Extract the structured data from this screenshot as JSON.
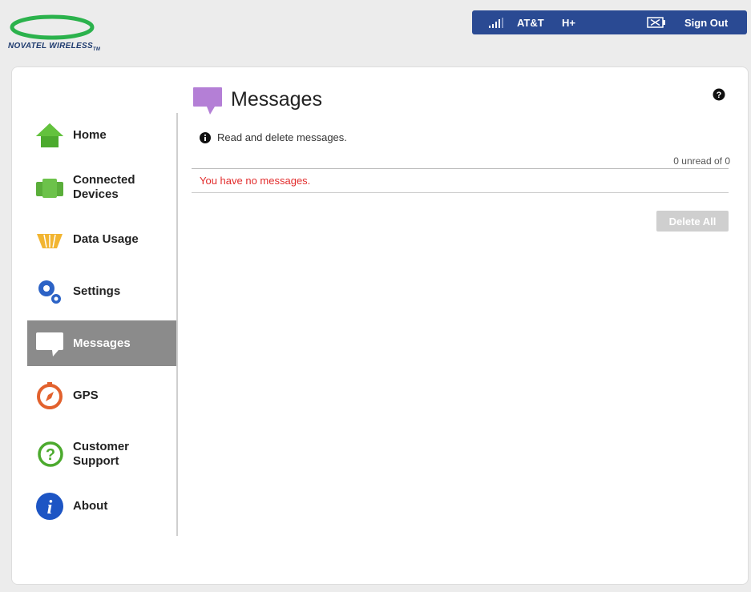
{
  "brand": {
    "logo_text": "NOVATEL WIRELESS",
    "logo_mark": "TM"
  },
  "status": {
    "carrier": "AT&T",
    "network": "H+",
    "sign_out_label": "Sign Out"
  },
  "nav": {
    "items": [
      {
        "label": "Home",
        "icon": "home-icon"
      },
      {
        "label": "Connected Devices",
        "icon": "connected-devices-icon"
      },
      {
        "label": "Data Usage",
        "icon": "data-usage-icon"
      },
      {
        "label": "Settings",
        "icon": "settings-gear-icon"
      },
      {
        "label": "Messages",
        "icon": "messages-icon",
        "active": true
      },
      {
        "label": "GPS",
        "icon": "compass-icon"
      },
      {
        "label": "Customer Support",
        "icon": "support-icon"
      },
      {
        "label": "About",
        "icon": "info-about-icon"
      }
    ]
  },
  "main": {
    "title": "Messages",
    "description": "Read and delete messages.",
    "unread_count": "0 unread of 0",
    "empty_message": "You have no messages.",
    "delete_all_label": "Delete All"
  },
  "colors": {
    "status_bar": "#2a4a93",
    "active_nav": "#8b8b8b",
    "empty_text": "#e22c2c",
    "messages_icon": "#b47fd6"
  }
}
